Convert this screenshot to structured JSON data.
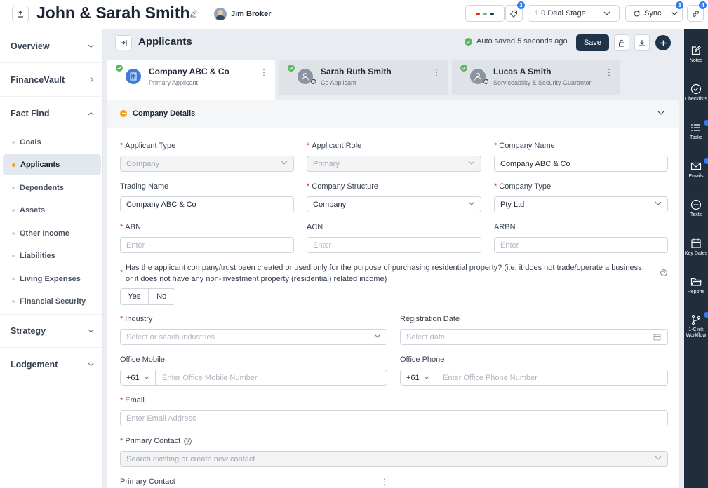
{
  "header": {
    "deal_title": "John & Sarah Smith",
    "broker_name": "Jim Broker",
    "notes_badge": "3",
    "deal_stage": "1.0 Deal Stage",
    "sync_label": "Sync",
    "sync_badge": "3",
    "links_badge": "4",
    "status_colors": [
      "#e02424",
      "#5cc85c",
      "#1f3349"
    ]
  },
  "nav": {
    "sections": [
      {
        "label": "Overview"
      },
      {
        "label": "FinanceVault"
      },
      {
        "label": "Fact Find"
      },
      {
        "label": "Strategy"
      },
      {
        "label": "Lodgement"
      }
    ],
    "fact_find_items": [
      {
        "label": "Goals"
      },
      {
        "label": "Applicants",
        "active": true
      },
      {
        "label": "Dependents"
      },
      {
        "label": "Assets"
      },
      {
        "label": "Other Income"
      },
      {
        "label": "Liabilities"
      },
      {
        "label": "Living Expenses"
      },
      {
        "label": "Financial Security"
      }
    ]
  },
  "main": {
    "title": "Applicants",
    "autosave": "Auto saved 5 seconds ago",
    "save_label": "Save",
    "applicants": [
      {
        "name": "Company ABC & Co",
        "role": "Primary Applicant"
      },
      {
        "name": "Sarah Ruth Smith",
        "role": "Co Applicant"
      },
      {
        "name": "Lucas A Smith",
        "role": "Serviceability & Security Guarantor"
      }
    ],
    "section_title": "Company Details",
    "form": {
      "applicant_type": {
        "label": "Applicant Type",
        "value": "Company"
      },
      "applicant_role": {
        "label": "Applicant Role",
        "value": "Primary"
      },
      "company_name": {
        "label": "Company Name",
        "value": "Company ABC & Co"
      },
      "trading_name": {
        "label": "Trading Name",
        "value": "Company ABC & Co"
      },
      "company_structure": {
        "label": "Company Structure",
        "value": "Company"
      },
      "company_type": {
        "label": "Company Type",
        "value": "Pty Ltd"
      },
      "abn": {
        "label": "ABN",
        "placeholder": "Enter"
      },
      "acn": {
        "label": "ACN",
        "placeholder": "Enter"
      },
      "arbn": {
        "label": "ARBN",
        "placeholder": "Enter"
      },
      "question_line1": "Has the applicant company/trust been created or used only for the purpose of purchasing residential property? (i.e. it does not trade/operate a business,",
      "question_line2": "or it does not have any non-investment property (residential) related income)",
      "yes_label": "Yes",
      "no_label": "No",
      "industry": {
        "label": "Industry",
        "placeholder": "Select or seach industries"
      },
      "registration_date": {
        "label": "Registration Date",
        "placeholder": "Select date"
      },
      "office_mobile": {
        "label": "Office Mobile",
        "code": "+61",
        "placeholder": "Enter Office Mobile Number"
      },
      "office_phone": {
        "label": "Office Phone",
        "code": "+61",
        "placeholder": "Enter Office Phone Number"
      },
      "email": {
        "label": "Email",
        "placeholder": "Enter Email Address"
      },
      "primary_contact": {
        "label": "Primary Contact",
        "placeholder": "Search existing or create new contact"
      },
      "primary_contact_sub": "Primary Contact"
    }
  },
  "rail": [
    {
      "label": "Notes",
      "icon": "edit-icon"
    },
    {
      "label": "Checklists",
      "icon": "check-circle-icon"
    },
    {
      "label": "Tasks",
      "icon": "list-icon"
    },
    {
      "label": "Emails",
      "icon": "mail-icon"
    },
    {
      "label": "Texts",
      "icon": "chat-icon"
    },
    {
      "label": "Key Dates",
      "icon": "calendar-icon"
    },
    {
      "label": "Reports",
      "icon": "folder-icon"
    },
    {
      "label": "1-Click",
      "label2": "Workflow",
      "icon": "workflow-icon"
    }
  ]
}
